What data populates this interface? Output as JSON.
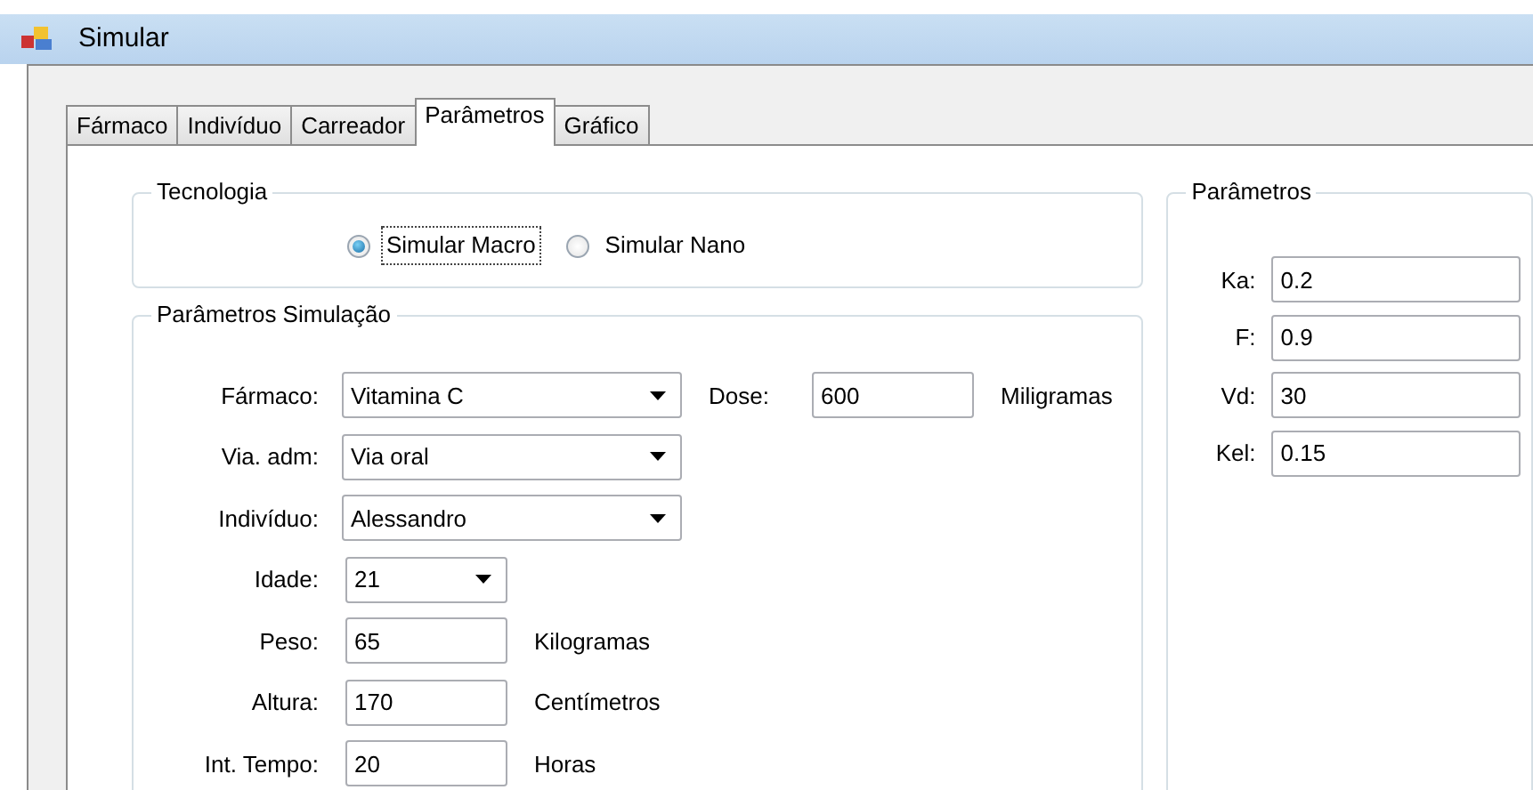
{
  "window": {
    "title": "Simular"
  },
  "tabs": [
    {
      "label": "Fármaco",
      "selected": false
    },
    {
      "label": "Indivíduo",
      "selected": false
    },
    {
      "label": "Carreador",
      "selected": false
    },
    {
      "label": "Parâmetros",
      "selected": true
    },
    {
      "label": "Gráfico",
      "selected": false
    }
  ],
  "tecnologia": {
    "title": "Tecnologia",
    "options": [
      {
        "label": "Simular Macro",
        "selected": true,
        "focused": true
      },
      {
        "label": "Simular Nano",
        "selected": false,
        "focused": false
      }
    ]
  },
  "simulacao": {
    "title": "Parâmetros Simulação",
    "rows": [
      {
        "items": [
          {
            "kind": "label",
            "text": "Fármaco:"
          },
          {
            "kind": "combo",
            "value": "Vitamina C"
          },
          {
            "kind": "inline-label",
            "text": "Dose:"
          },
          {
            "kind": "field",
            "value": "600"
          },
          {
            "kind": "unit",
            "text": "Miligramas"
          }
        ]
      },
      {
        "items": [
          {
            "kind": "label",
            "text": "Via. adm:"
          },
          {
            "kind": "combo",
            "value": "Via oral"
          }
        ]
      },
      {
        "items": [
          {
            "kind": "label",
            "text": "Indivíduo:"
          },
          {
            "kind": "combo",
            "value": "Alessandro"
          }
        ]
      },
      {
        "items": [
          {
            "kind": "label",
            "text": "Idade:"
          },
          {
            "kind": "short-combo",
            "value": "21"
          }
        ]
      },
      {
        "items": [
          {
            "kind": "label",
            "text": "Peso:"
          },
          {
            "kind": "field",
            "value": "65"
          },
          {
            "kind": "unit",
            "text": "Kilogramas"
          }
        ]
      },
      {
        "items": [
          {
            "kind": "label",
            "text": "Altura:"
          },
          {
            "kind": "field",
            "value": "170"
          },
          {
            "kind": "unit",
            "text": "Centímetros"
          }
        ]
      },
      {
        "items": [
          {
            "kind": "label",
            "text": "Int. Tempo:"
          },
          {
            "kind": "field",
            "value": "20"
          },
          {
            "kind": "unit",
            "text": "Horas"
          }
        ]
      }
    ]
  },
  "parametros": {
    "title": "Parâmetros",
    "rows": [
      {
        "label": "Ka:",
        "value": "0.2"
      },
      {
        "label": "F:",
        "value": "0.9"
      },
      {
        "label": "Vd:",
        "value": "30"
      },
      {
        "label": "Kel:",
        "value": "0.15"
      }
    ]
  }
}
